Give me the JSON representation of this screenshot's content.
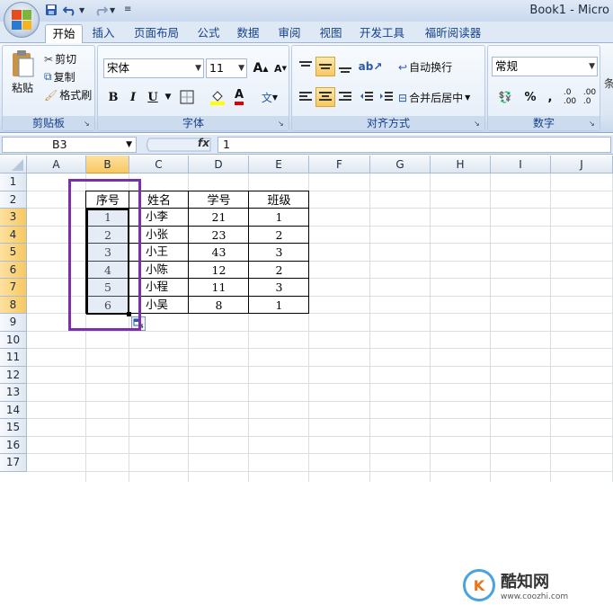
{
  "window": {
    "title": "Book1 - Micro"
  },
  "tabs": [
    "开始",
    "插入",
    "页面布局",
    "公式",
    "数据",
    "审阅",
    "视图",
    "开发工具",
    "福昕阅读器"
  ],
  "active_tab": "开始",
  "clipboard": {
    "paste": "粘贴",
    "cut": "剪切",
    "copy": "复制",
    "format_painter": "格式刷",
    "label": "剪贴板"
  },
  "font": {
    "name": "宋体",
    "size": "11",
    "bold": "B",
    "italic": "I",
    "underline": "U",
    "label": "字体",
    "grow": "A",
    "shrink": "A",
    "color": "A",
    "phonetic": "文"
  },
  "alignment": {
    "wrap": "自动换行",
    "merge": "合并后居中",
    "label": "对齐方式"
  },
  "number": {
    "format": "常规",
    "percent": "%",
    "comma": ",",
    "inc_dec": ".0→.00",
    "dec_dec": ".00→.0",
    "label": "数字"
  },
  "formula_bar": {
    "name_box": "B3",
    "fx": "fx",
    "value": "1"
  },
  "columns": [
    "A",
    "B",
    "C",
    "D",
    "E",
    "F",
    "G",
    "H",
    "I",
    "J"
  ],
  "rows": [
    "1",
    "2",
    "3",
    "4",
    "5",
    "6",
    "7",
    "8",
    "9",
    "10",
    "11",
    "12",
    "13",
    "14",
    "15",
    "16",
    "17"
  ],
  "table": {
    "headers": [
      "序号",
      "姓名",
      "学号",
      "班级"
    ],
    "rows": [
      [
        "1",
        "小李",
        "21",
        "1"
      ],
      [
        "2",
        "小张",
        "23",
        "2"
      ],
      [
        "3",
        "小王",
        "43",
        "3"
      ],
      [
        "4",
        "小陈",
        "12",
        "2"
      ],
      [
        "5",
        "小程",
        "11",
        "3"
      ],
      [
        "6",
        "小吴",
        "8",
        "1"
      ]
    ]
  },
  "watermark": {
    "brand": "酷知网",
    "url": "www.coozhi.com"
  },
  "colors": {
    "highlight_frame": "#7b2fa8",
    "selection_border": "#000000",
    "fill_highlight": "#ffff00",
    "font_color_red": "#e00000"
  }
}
